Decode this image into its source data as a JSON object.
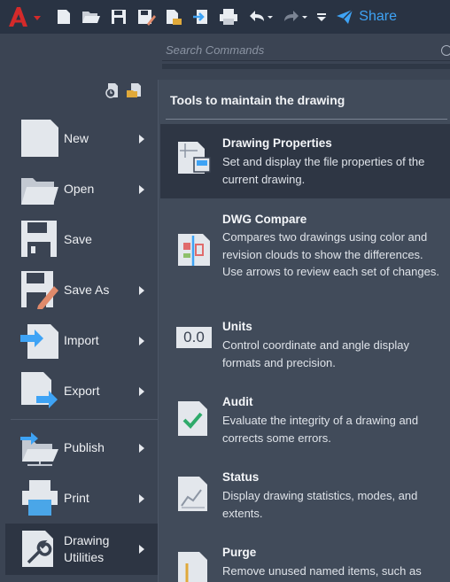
{
  "quick_access": {
    "app_button": "A",
    "icons": [
      "new-icon",
      "open-icon",
      "save-icon",
      "save-as-icon",
      "open-from-web-icon",
      "export-icon",
      "print-icon",
      "undo-icon",
      "redo-icon",
      "customize-icon"
    ],
    "share_label": "Share"
  },
  "search": {
    "placeholder": "Search Commands"
  },
  "menu": {
    "items": [
      {
        "label": "New",
        "has_arrow": true
      },
      {
        "label": "Open",
        "has_arrow": true
      },
      {
        "label": "Save",
        "has_arrow": false
      },
      {
        "label": "Save As",
        "has_arrow": true
      },
      {
        "label": "Import",
        "has_arrow": true
      },
      {
        "label": "Export",
        "has_arrow": true
      },
      {
        "label": "Publish",
        "has_arrow": true
      },
      {
        "label": "Print",
        "has_arrow": true
      },
      {
        "label": "Drawing\nUtilities",
        "has_arrow": true,
        "active": true
      }
    ]
  },
  "panel": {
    "title": "Tools to maintain the drawing",
    "tools": [
      {
        "title": "Drawing Properties",
        "desc": "Set and display the file properties of the current drawing.",
        "active": true
      },
      {
        "title": "DWG Compare",
        "desc": "Compares two drawings using color and revision clouds to show the differences. Use arrows to review each set of changes."
      },
      {
        "title": "Units",
        "desc": "Control coordinate and angle display formats and precision.",
        "icon_text": "0.0"
      },
      {
        "title": "Audit",
        "desc": "Evaluate the integrity of a drawing and corrects some errors."
      },
      {
        "title": "Status",
        "desc": "Display drawing statistics, modes, and extents."
      },
      {
        "title": "Purge",
        "desc": "Remove unused named items, such as"
      }
    ]
  },
  "colors": {
    "accent": "#3ea3f5",
    "app_red": "#d42a2a",
    "bg": "#3b4453",
    "panel": "#414b5a"
  }
}
